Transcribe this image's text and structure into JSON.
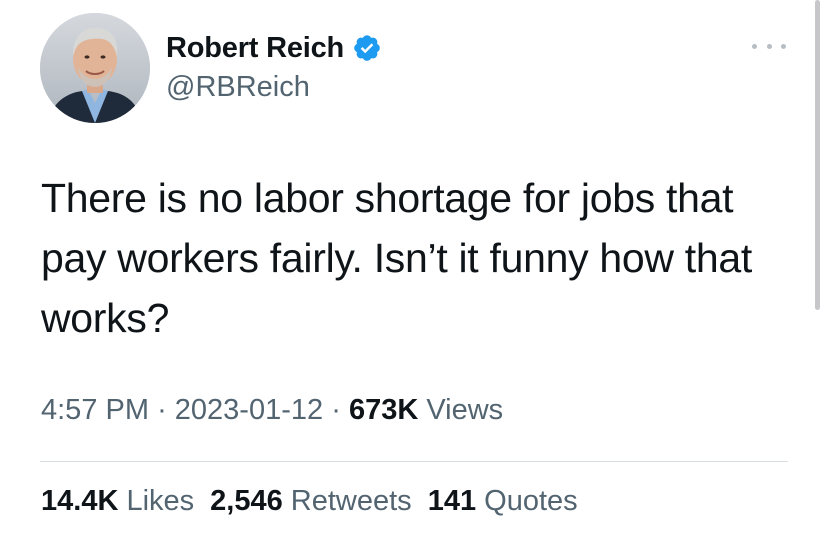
{
  "author": {
    "display_name": "Robert Reich",
    "handle": "@RBReich",
    "verified_icon": "verified-badge-icon",
    "avatar_icon": "profile-avatar"
  },
  "tweet": {
    "text": "There is no labor shortage for jobs that pay workers fairly. Isn’t it funny how that works?"
  },
  "meta": {
    "time": "4:57 PM",
    "separator": "·",
    "date": "2023-01-12",
    "views_count": "673K",
    "views_label": "Views"
  },
  "stats": {
    "likes_count": "14.4K",
    "likes_label": "Likes",
    "retweets_count": "2,546",
    "retweets_label": "Retweets",
    "quotes_count": "141",
    "quotes_label": "Quotes"
  },
  "colors": {
    "verified_blue": "#1d9bf0",
    "text_primary": "#0f1419",
    "text_secondary": "#536471"
  }
}
